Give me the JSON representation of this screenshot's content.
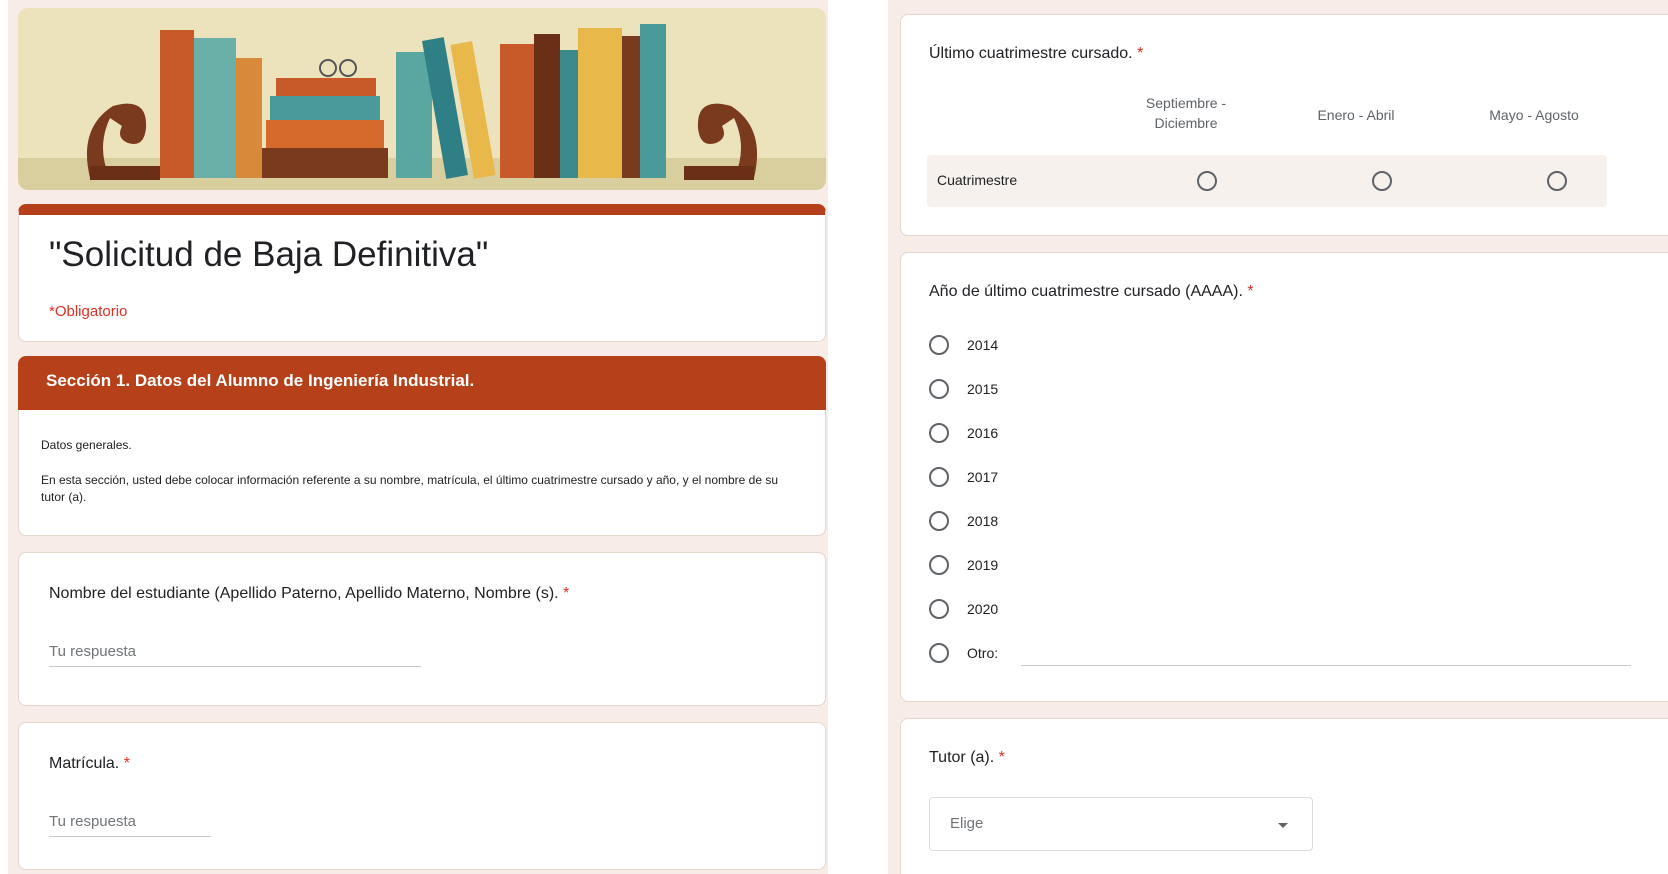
{
  "left": {
    "form_title": "\"Solicitud de Baja Definitiva\"",
    "required_note": "*Obligatorio",
    "section": {
      "title": "Sección 1. Datos del Alumno de Ingeniería Industrial.",
      "desc1": "Datos generales.",
      "desc2": "En esta sección, usted debe colocar información referente a su nombre, matrícula, el último cuatrimestre cursado y año, y el nombre de su tutor (a)."
    },
    "q_name": {
      "label": "Nombre del estudiante (Apellido Paterno, Apellido Materno, Nombre (s).",
      "placeholder": "Tu respuesta"
    },
    "q_matricula": {
      "label": "Matrícula.",
      "placeholder": "Tu respuesta"
    },
    "required_mark": "*"
  },
  "right": {
    "q_cuatrimestre": {
      "label": "Último cuatrimestre cursado.",
      "columns": [
        "Septiembre - Diciembre",
        "Enero - Abril",
        "Mayo - Agosto"
      ],
      "row_label": "Cuatrimestre"
    },
    "q_year": {
      "label": "Año de último cuatrimestre cursado (AAAA).",
      "options": [
        "2014",
        "2015",
        "2016",
        "2017",
        "2018",
        "2019",
        "2020"
      ],
      "other_label": "Otro:"
    },
    "q_tutor": {
      "label": "Tutor (a).",
      "select_placeholder": "Elige"
    }
  },
  "colors": {
    "accent": "#b5401a",
    "required": "#d93025",
    "background": "#f7ece7"
  },
  "icons": {
    "dropdown": "caret-down-icon",
    "radio": "radio-empty-icon"
  }
}
